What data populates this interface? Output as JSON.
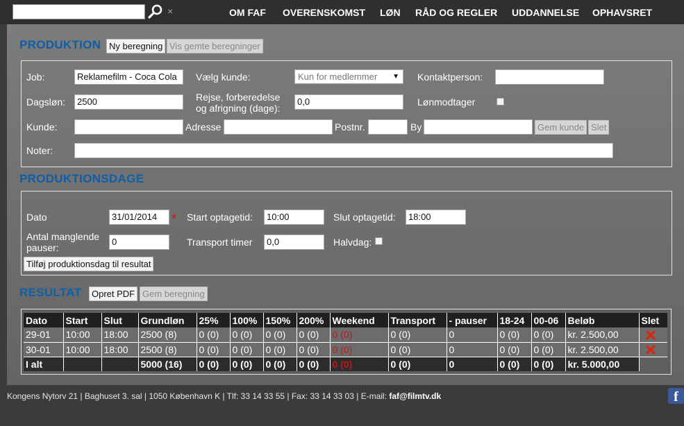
{
  "nav": {
    "search_value": "",
    "clear_glyph": "×",
    "items": [
      "OM FAF",
      "OVERENSKOMST",
      "LØN",
      "RÅD OG REGLER",
      "UDDANNELSE",
      "OPHAVSRET"
    ]
  },
  "produktion": {
    "title": "PRODUKTION",
    "new_button": "Ny beregning",
    "saved_button": "Vis gemte beregninger",
    "job_label": "Job:",
    "job_value": "Reklamefilm - Coca Cola",
    "customer_label": "Vælg kunde:",
    "customer_value": "Kun for medlemmer",
    "contact_label": "Kontaktperson:",
    "contact_value": "",
    "dagslon_label": "Dagsløn:",
    "dagslon_value": "2500",
    "travel_label_1": "Rejse, forberedelse",
    "travel_label_2": "og afrigning (dage):",
    "travel_value": "0,0",
    "employee_label": "Lønmodtager",
    "kunde_label": "Kunde:",
    "address_label": "Adresse",
    "postnr_label": "Postnr.",
    "city_label": "By",
    "save_customer_button": "Gem kunde",
    "delete_customer_button": "Slet",
    "notes_label": "Noter:"
  },
  "dage": {
    "title": "PRODUKTIONSDAGE",
    "date_label": "Dato",
    "date_value": "31/01/2014",
    "clear_glyph": "×",
    "start_label": "Start optagetid:",
    "start_value": "10:00",
    "end_label": "Slut optagetid:",
    "end_value": "18:00",
    "pauses_label_1": "Antal manglende",
    "pauses_label_2": "pauser:",
    "pauses_value": "0",
    "transport_label": "Transport timer",
    "transport_value": "0,0",
    "halfday_label": "Halvdag:",
    "add_button": "Tilføj produktionsdag til resultat"
  },
  "resultat": {
    "title": "RESULTAT",
    "pdf_button": "Opret PDF",
    "save_button": "Gem beregning",
    "headers": [
      "Dato",
      "Start",
      "Slut",
      "Grundløn",
      "25%",
      "100%",
      "150%",
      "200%",
      "Weekend",
      "Transport",
      "- pauser",
      "18-24",
      "00-06",
      "Beløb",
      "Slet"
    ],
    "rows": [
      [
        "29-01",
        "10:00",
        "18:00",
        "2500 (8)",
        "0 (0)",
        "0 (0)",
        "0 (0)",
        "0 (0)",
        "0 (0)",
        "0 (0)",
        "0",
        "0 (0)",
        "0 (0)",
        "kr. 2.500,00"
      ],
      [
        "30-01",
        "10:00",
        "18:00",
        "2500 (8)",
        "0 (0)",
        "0 (0)",
        "0 (0)",
        "0 (0)",
        "0 (0)",
        "0 (0)",
        "0",
        "0 (0)",
        "0 (0)",
        "kr. 2.500,00"
      ]
    ],
    "total": [
      "I alt",
      "",
      "",
      "5000 (16)",
      "0 (0)",
      "0 (0)",
      "0 (0)",
      "0 (0)",
      "0 (0)",
      "0 (0)",
      "0",
      "0 (0)",
      "0 (0)",
      "kr. 5.000,00"
    ]
  },
  "footer": {
    "address": "Kongens Nytorv 21 | Baghuset 3. sal | 1050 København K | Tlf: 33 14 33 55 | Fax: 33 14 33 03 | E-mail: ",
    "email": "faf@filmtv.dk",
    "fb_glyph": "f"
  }
}
